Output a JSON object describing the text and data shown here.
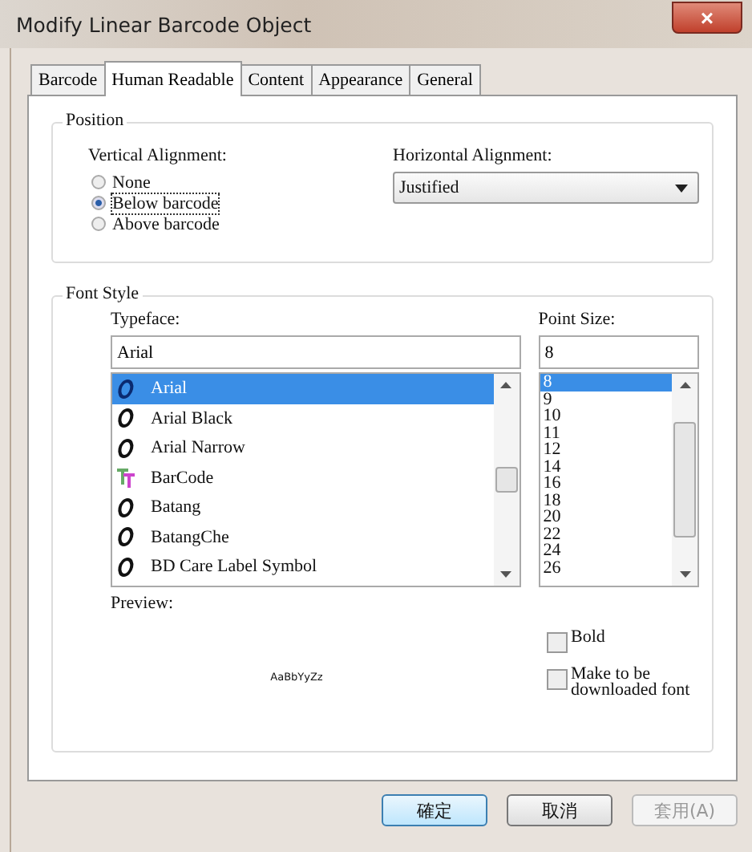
{
  "window": {
    "title": "Modify Linear Barcode Object",
    "close": "×"
  },
  "tabs": [
    {
      "label": "Barcode",
      "selected": false
    },
    {
      "label": "Human Readable",
      "selected": true
    },
    {
      "label": "Content",
      "selected": false
    },
    {
      "label": "Appearance",
      "selected": false
    },
    {
      "label": "General",
      "selected": false
    }
  ],
  "position": {
    "title": "Position",
    "vertical_label": "Vertical Alignment:",
    "options": [
      {
        "label": "None",
        "selected": false
      },
      {
        "label": "Below barcode",
        "selected": true
      },
      {
        "label": "Above barcode",
        "selected": false
      }
    ],
    "horizontal_label": "Horizontal Alignment:",
    "horizontal_value": "Justified"
  },
  "font_style": {
    "title": "Font Style",
    "typeface_label": "Typeface:",
    "typeface_value": "Arial",
    "typefaces": [
      {
        "name": "Arial",
        "kind": "opentype",
        "selected": true
      },
      {
        "name": "Arial Black",
        "kind": "opentype",
        "selected": false
      },
      {
        "name": "Arial Narrow",
        "kind": "opentype",
        "selected": false
      },
      {
        "name": "BarCode",
        "kind": "truetype",
        "selected": false
      },
      {
        "name": "Batang",
        "kind": "opentype",
        "selected": false
      },
      {
        "name": "BatangChe",
        "kind": "opentype",
        "selected": false
      },
      {
        "name": "BD Care Label Symbol",
        "kind": "opentype",
        "selected": false
      }
    ],
    "size_label": "Point Size:",
    "size_value": "8",
    "sizes": [
      {
        "label": "8",
        "selected": true
      },
      {
        "label": "9",
        "selected": false
      },
      {
        "label": "10",
        "selected": false
      },
      {
        "label": "11",
        "selected": false
      },
      {
        "label": "12",
        "selected": false
      },
      {
        "label": "14",
        "selected": false
      },
      {
        "label": "16",
        "selected": false
      },
      {
        "label": "18",
        "selected": false
      },
      {
        "label": "20",
        "selected": false
      },
      {
        "label": "22",
        "selected": false
      },
      {
        "label": "24",
        "selected": false
      },
      {
        "label": "26",
        "selected": false
      }
    ],
    "preview_label": "Preview:",
    "preview_text": "AaBbYyZz",
    "checkboxes": [
      {
        "label": "Bold",
        "checked": false
      },
      {
        "label": "Make to be downloaded font",
        "checked": false
      }
    ]
  },
  "buttons": [
    {
      "label": "確定",
      "disabled": false,
      "default": true
    },
    {
      "label": "取消",
      "disabled": false,
      "default": false
    },
    {
      "label": "套用(A)",
      "disabled": true,
      "default": false
    }
  ]
}
